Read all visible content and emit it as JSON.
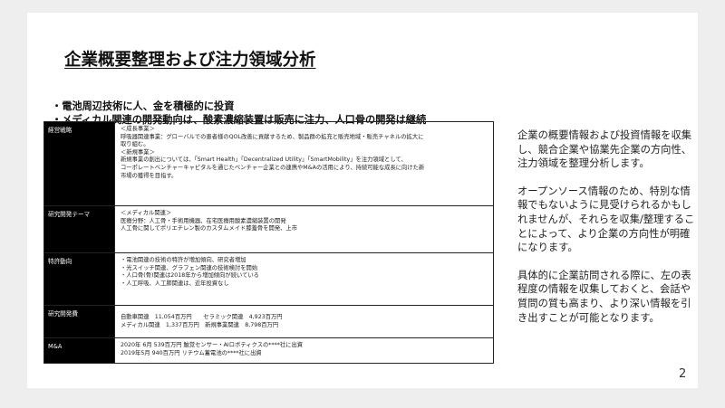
{
  "title": "企業概要整理および注力領域分析",
  "bullets": [
    "・電池周辺技術に人、金を積極的に投資",
    "・メディカル関連の開発動向は、酸素濃縮装置は販売に注力、人口骨の開発は継続"
  ],
  "table": [
    {
      "key": "経営戦略",
      "lines": [
        "＜成長事業＞",
        "呼吸器関連事業：グローバルでの患者様のQOL改善に貢献するため、製品群の拡充と販売地域・販売チャネルの拡大に",
        "取り組む。",
        "＜新規事業＞",
        "新規事業の創出については、「Smart Health」「Decentralized Utility」「SmartMobility」を注力領域として、",
        "コーポレートベンチャーキャピタルを通じたベンチャー企業との連携やM&Aの活用により、持続可能な成長に向けた新",
        "市場の獲得を目指す。"
      ]
    },
    {
      "key": "研究開発テーマ",
      "lines": [
        "＜メディカル関連＞",
        "医療分野：人工骨・手術用機器、在宅医療用酸素濃縮装置の開発",
        "人工骨に関してポリエチレン製のカスタムメイド膝蓋骨を開発、上市"
      ]
    },
    {
      "key": "特許動向",
      "lines": [
        "・電池関連の技術の特許が増加傾向、研究者増加",
        "・光スイッチ関連、グラフェン関連の技術検討を開始",
        "・人口骨(骨)関連は2018年から増加傾向が続いている",
        "・人工呼吸、人工肺関連は、近年投資なし"
      ]
    },
    {
      "key": "研究開発費",
      "lines": [
        "自動車関連　11,054百万円　　セラミック関連　4,923百万円",
        "メディカル関連　1,337百万円　新規事業関連　8,798百万円"
      ]
    },
    {
      "key": "M&A",
      "lines": [
        "2020年 6月 539百万円 触覚センサー・AIロボティクスの****社に出資",
        "2019年5月  940百万円 リチウム蓄電池の****社に出資"
      ]
    }
  ],
  "side_paragraphs": [
    "企業の概要情報および投資情報を収集し、競合企業や協業先企業の方向性、注力領域を整理分析します。",
    "オープンソース情報のため、特別な情報でもないように見受けられるかもしれませんが、それらを収集/整理することによって、より企業の方向性が明確になります。",
    "具体的に企業訪問される際に、左の表程度の情報を収集しておくと、会話や質問の質も高まり、より深い情報を引き出すことが可能となります。"
  ],
  "page_number": "2"
}
